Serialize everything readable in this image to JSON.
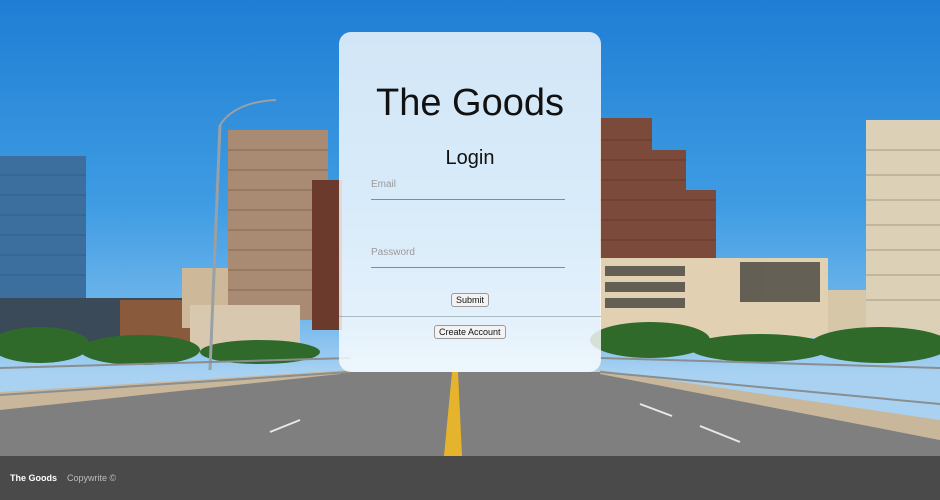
{
  "app": {
    "title": "The Goods"
  },
  "login": {
    "heading": "Login",
    "email_placeholder": "Email",
    "password_placeholder": "Password",
    "submit_label": "Submit",
    "create_account_label": "Create Account"
  },
  "footer": {
    "brand": "The Goods",
    "copyright": "Copywrite ©"
  },
  "colors": {
    "footer_bg": "#4a4a4a",
    "card_bg": "rgba(255,255,255,0.80)",
    "sky": "#2f8fd8"
  }
}
